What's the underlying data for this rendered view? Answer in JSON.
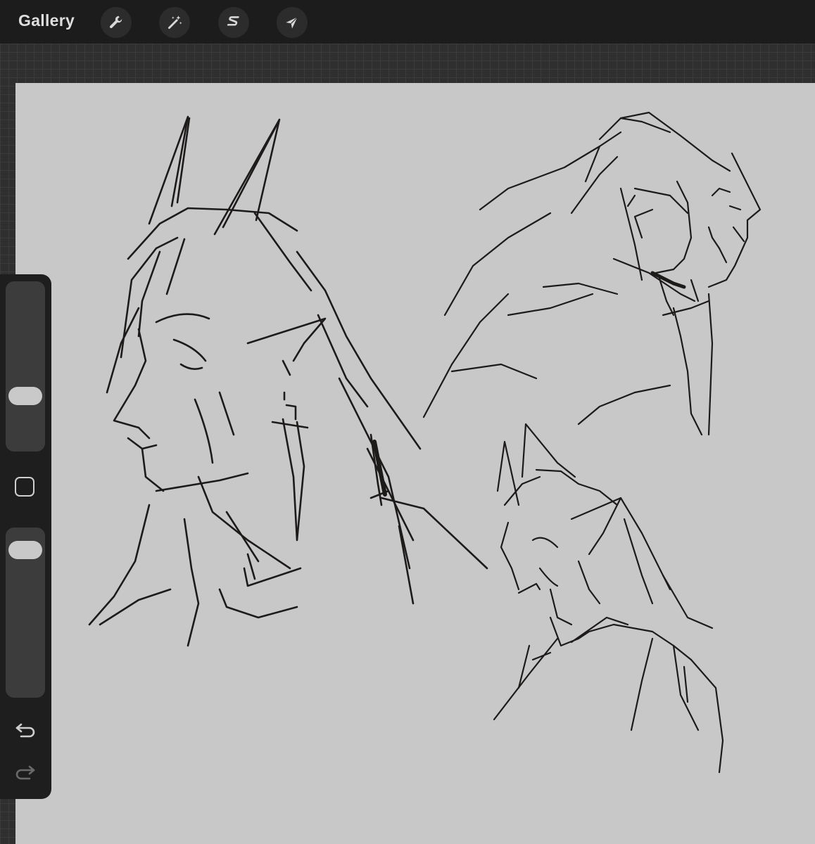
{
  "app": {
    "gallery_label": "Gallery"
  },
  "toolbar": {
    "tools": [
      {
        "name": "actions",
        "icon": "wrench-icon"
      },
      {
        "name": "adjustments",
        "icon": "magic-wand-icon"
      },
      {
        "name": "selection",
        "icon": "selection-s-icon"
      },
      {
        "name": "transform",
        "icon": "arrow-cursor-icon"
      }
    ]
  },
  "sidebar": {
    "brush_size_level": 0.3,
    "brush_opacity_level": 0.92,
    "modify_icon": "square-modify-icon",
    "undo_icon": "undo-arrow-icon",
    "redo_icon": "redo-arrow-icon",
    "redo_enabled": false
  },
  "colors": {
    "canvas": "#c8c8c8",
    "topbar": "#1c1c1c",
    "ink": "#1d1a1a"
  }
}
